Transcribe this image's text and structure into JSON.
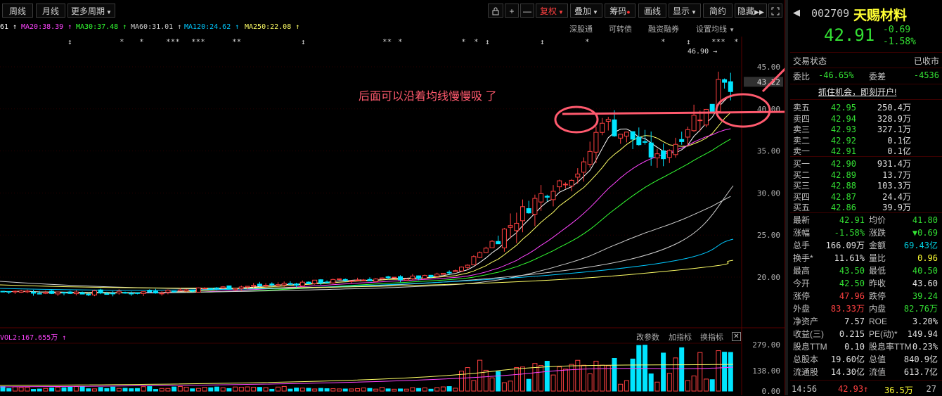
{
  "toolbar": {
    "weekly": "周线",
    "monthly": "月线",
    "more_periods": "更多周期",
    "plus": "+",
    "minus": "—",
    "adjust": "复权",
    "overlay": "叠加",
    "chips": "筹码",
    "draw": "画线",
    "display": "显示",
    "simple": "简约",
    "hide": "隐藏"
  },
  "ma_legend": [
    {
      "text": "61 ↑",
      "color": "#ffffff"
    },
    {
      "text": "MA20:38.39 ↑",
      "color": "#ff44ff"
    },
    {
      "text": "MA30:37.48 ↑",
      "color": "#33ff33"
    },
    {
      "text": "MA60:31.01 ↑",
      "color": "#d0d0d0"
    },
    {
      "text": "MA120:24.62 ↑",
      "color": "#00c8ff"
    },
    {
      "text": "MA250:22.08 ↑",
      "color": "#ffff66"
    }
  ],
  "top_right_links": {
    "shengutong": "深股通",
    "convertible": "可转债",
    "margin": "融资融券",
    "set_ma": "设置均线"
  },
  "price_axis": [
    "45.00",
    "40.00",
    "35.00",
    "30.00",
    "25.00",
    "20.00"
  ],
  "price_tag": "43.22",
  "high_label": "46.90 →",
  "annotation": "后面可以沿着均线慢慢吸 了",
  "volume": {
    "label": "VOL2:167.655万 ↑",
    "modify": "改参数",
    "add": "加指标",
    "switch": "换指标",
    "axis": [
      "279.00",
      "138.00",
      "0.00"
    ]
  },
  "stock": {
    "code": "002709",
    "name": "天赐材料",
    "price": "42.91",
    "change": "-0.69",
    "pct": "-1.58%",
    "trade_status_label": "交易状态",
    "trade_status": "已收市",
    "ratio_label": "委比",
    "ratio": "-46.65%",
    "diff_label": "委差",
    "diff": "-4536",
    "promo": "抓住机会，即刻开户!"
  },
  "asks": [
    {
      "label": "卖五",
      "price": "42.95",
      "vol": "250.4万"
    },
    {
      "label": "卖四",
      "price": "42.94",
      "vol": "328.9万"
    },
    {
      "label": "卖三",
      "price": "42.93",
      "vol": "327.1万"
    },
    {
      "label": "卖二",
      "price": "42.92",
      "vol": "0.1亿"
    },
    {
      "label": "卖一",
      "price": "42.91",
      "vol": "0.1亿"
    }
  ],
  "bids": [
    {
      "label": "买一",
      "price": "42.90",
      "vol": "931.4万"
    },
    {
      "label": "买二",
      "price": "42.89",
      "vol": "13.7万"
    },
    {
      "label": "买三",
      "price": "42.88",
      "vol": "103.3万"
    },
    {
      "label": "买四",
      "price": "42.87",
      "vol": "24.4万"
    },
    {
      "label": "买五",
      "price": "42.86",
      "vol": "39.9万"
    }
  ],
  "stats": [
    {
      "l1": "最新",
      "v1": "42.91",
      "c1": "dn",
      "l2": "均价",
      "v2": "41.80",
      "c2": "dn"
    },
    {
      "l1": "涨幅",
      "v1": "-1.58%",
      "c1": "dn",
      "l2": "涨跌",
      "v2": "▼0.69",
      "c2": "dn"
    },
    {
      "l1": "总手",
      "v1": "166.09万",
      "c1": "wh",
      "l2": "金额",
      "v2": "69.43亿",
      "c2": "cy"
    },
    {
      "l1": "换手*",
      "v1": "11.61%",
      "c1": "wh",
      "l2": "量比",
      "v2": "0.96",
      "c2": "yel"
    },
    {
      "l1": "最高",
      "v1": "43.50",
      "c1": "dn",
      "l2": "最低",
      "v2": "40.50",
      "c2": "dn"
    },
    {
      "l1": "今开",
      "v1": "42.50",
      "c1": "dn",
      "l2": "昨收",
      "v2": "43.60",
      "c2": "wh"
    },
    {
      "l1": "涨停",
      "v1": "47.96",
      "c1": "up",
      "l2": "跌停",
      "v2": "39.24",
      "c2": "dn"
    },
    {
      "l1": "外盘",
      "v1": "83.33万",
      "c1": "up",
      "l2": "内盘",
      "v2": "82.76万",
      "c2": "dn"
    },
    {
      "l1": "净资产",
      "v1": "7.57",
      "c1": "wh",
      "l2": "ROE",
      "v2": "3.20%",
      "c2": "wh"
    },
    {
      "l1": "收益(三)",
      "v1": "0.215",
      "c1": "wh",
      "l2": "PE(动)*",
      "v2": "149.94",
      "c2": "wh"
    },
    {
      "l1": "股息TTM",
      "v1": "0.10",
      "c1": "wh",
      "l2": "股息率TTM",
      "v2": "0.23%",
      "c2": "wh"
    },
    {
      "l1": "总股本",
      "v1": "19.60亿",
      "c1": "wh",
      "l2": "总值",
      "v2": "840.9亿",
      "c2": "wh"
    },
    {
      "l1": "流通股",
      "v1": "14.30亿",
      "c1": "wh",
      "l2": "流值",
      "v2": "613.7亿",
      "c2": "wh"
    }
  ],
  "tick": {
    "time": "14:56",
    "price": "42.93↑",
    "vol": "36.5万",
    "count": "27"
  },
  "colors": {
    "up": "#ff4040",
    "down": "#33e033",
    "cyan": "#00d0e0",
    "annotation": "#ff5a6e"
  }
}
